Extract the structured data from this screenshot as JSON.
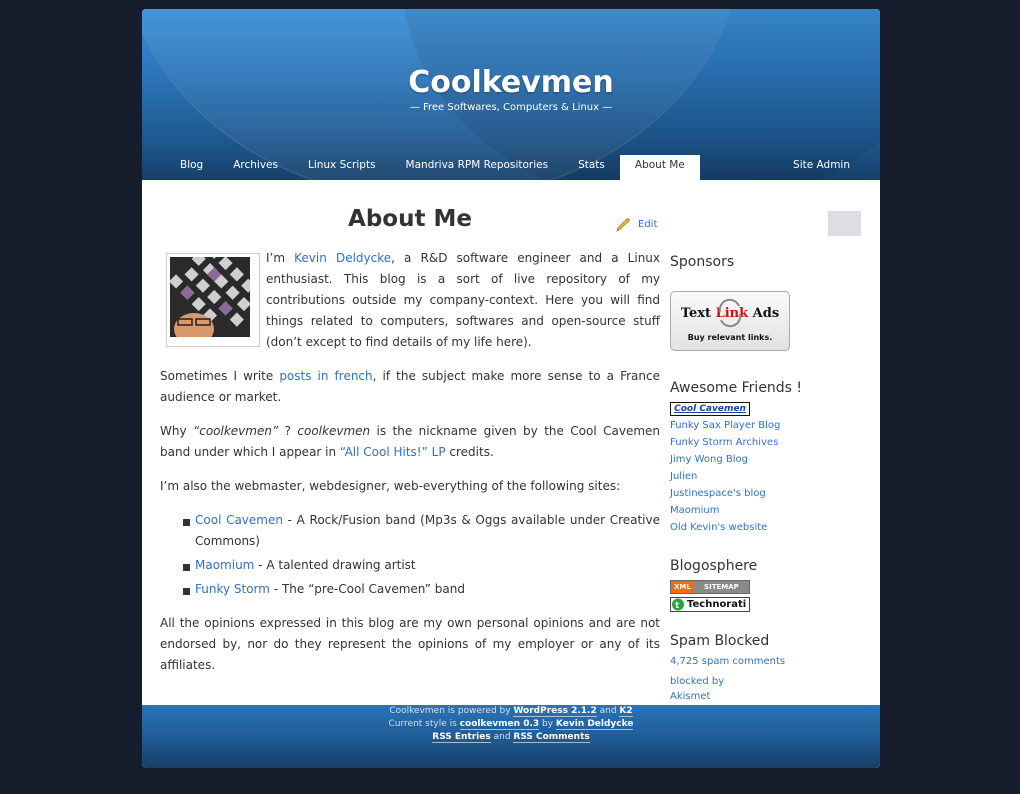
{
  "header": {
    "title": "Coolkevmen",
    "tagline": "— Free Softwares, Computers & Linux —"
  },
  "nav": {
    "items": [
      {
        "label": "Blog"
      },
      {
        "label": "Archives"
      },
      {
        "label": "Linux Scripts"
      },
      {
        "label": "Mandriva RPM Repositories"
      },
      {
        "label": "Stats"
      },
      {
        "label": "About Me",
        "active": true
      }
    ],
    "site_admin": "Site Admin"
  },
  "page": {
    "title": "About Me",
    "edit_label": "Edit"
  },
  "content": {
    "p1_before": "I’m ",
    "p1_link": "Kevin Deldycke",
    "p1_after": ", a R&D software engineer and a Linux enthusiast. This blog is a sort of live repository of my contributions outside my company-context. Here you will find things related to computers, softwares and open-source stuff (don’t except to find details of my life here).",
    "p2_before": "Sometimes I write ",
    "p2_link": "posts in french",
    "p2_after": ", if the subject make more sense to a France audience or market.",
    "p3_a": "Why ",
    "p3_b": "“coolkevmen”",
    "p3_c": " ? ",
    "p3_d": "coolkevmen",
    "p3_e": " is the nickname given by the Cool Cavemen band under which I appear in ",
    "p3_link": "“All Cool Hits!” LP",
    "p3_f": " credits.",
    "p4": "I’m also the webmaster, webdesigner, web-everything of the following sites:",
    "sites": [
      {
        "link": "Cool Cavemen",
        "desc": " - A Rock/Fusion band (Mp3s & Oggs available under Creative Commons)"
      },
      {
        "link": "Maomium",
        "desc": " - A talented drawing artist"
      },
      {
        "link": "Funky Storm",
        "desc": " - The “pre-Cool Cavemen” band"
      }
    ],
    "p5": "All the opinions expressed in this blog are my own personal opinions and are not endorsed by, nor do they represent the opinions of my employer or any of its affiliates."
  },
  "sidebar": {
    "sponsors_heading": "Sponsors",
    "textlink_line1a": "Text",
    "textlink_line1b": "Link",
    "textlink_line1c": "Ads",
    "textlink_line2": "Buy relevant links.",
    "friends_heading": "Awesome Friends !",
    "friends_badge": "Cool Cavemen",
    "friends": [
      "Funky Sax Player Blog",
      "Funky Storm Archives",
      "Jimy Wong Blog",
      "Julien",
      "Justinespace's blog",
      "Maomium",
      "Old Kevin's website"
    ],
    "blogosphere_heading": "Blogosphere",
    "xml_badge_a": "XML",
    "xml_badge_b": "SITEMAP",
    "technorati_badge": "Technorati",
    "spam_heading": "Spam Blocked",
    "spam_count": "4,725 spam comments",
    "spam_by": "blocked by",
    "spam_akismet": "Akismet"
  },
  "footer": {
    "l1a": "Coolkevmen is powered by ",
    "l1b": "WordPress 2.1.2",
    "l1c": " and ",
    "l1d": "K2",
    "l2a": "Current style is ",
    "l2b": "coolkevmen 0.3",
    "l2c": " by ",
    "l2d": "Kevin Deldycke",
    "l3a": "RSS Entries",
    "l3b": " and ",
    "l3c": "RSS Comments"
  },
  "colors": {
    "link": "#3171c6",
    "header_blue": "#2b74b8",
    "background": "#161e2e"
  }
}
